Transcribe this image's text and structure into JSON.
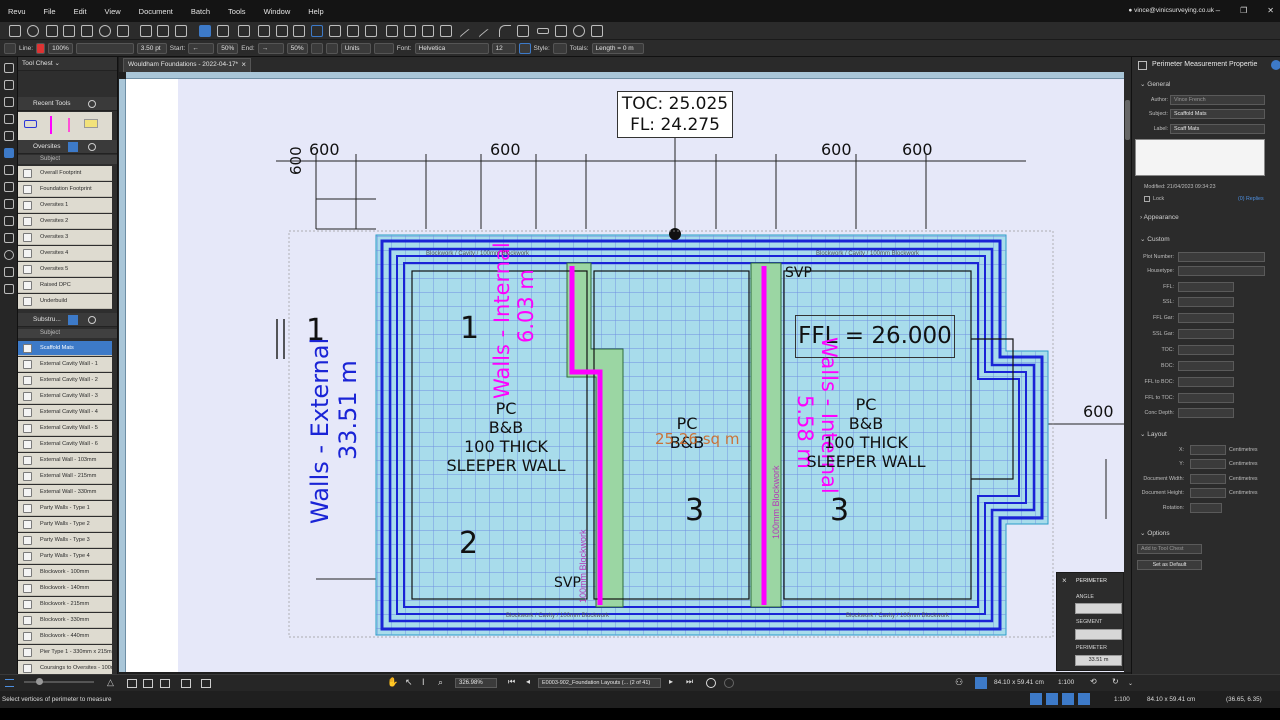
{
  "menubar": {
    "items": [
      "Revu",
      "File",
      "Edit",
      "View",
      "Document",
      "Batch",
      "Tools",
      "Window",
      "Help"
    ],
    "user_email": "vince@vinicsurveying.co.uk"
  },
  "toolbar2": {
    "line_label": "Line:",
    "opacity": "100%",
    "thickness": "3.50 pt",
    "start_label": "Start:",
    "start_pct": "50%",
    "end_label": "End:",
    "end_pct": "50%",
    "units_label": "Units",
    "font_label": "Font:",
    "font_value": "Helvetica",
    "font_size": "12",
    "style_label": "Style:",
    "totals_label": "Totals:",
    "totals_value": "Length = 0 m"
  },
  "toolchest": {
    "title": "Tool Chest",
    "recent_tools": "Recent Tools",
    "group1_name": "Oversites",
    "subject_header": "Subject",
    "group1_items": [
      "Overall Footprint",
      "Foundation Footprint",
      "Oversites 1",
      "Oversites 2",
      "Oversites 3",
      "Oversites 4",
      "Oversites 5",
      "Raised DPC",
      "Underbuild"
    ],
    "group2_name": "Substru...",
    "group2_items": [
      "Scaffold Mats",
      "External Cavity Wall - 1",
      "External Cavity Wall - 2",
      "External Cavity Wall - 3",
      "External Cavity Wall - 4",
      "External Cavity Wall - 5",
      "External Cavity Wall - 6",
      "External Wall - 103mm",
      "External Wall - 215mm",
      "External Wall - 330mm",
      "Party Walls - Type 1",
      "Party Walls - Type 2",
      "Party Walls - Type 3",
      "Party Walls - Type 4",
      "Blockwork - 100mm",
      "Blockwork - 140mm",
      "Blockwork - 215mm",
      "Blockwork - 330mm",
      "Blockwork - 440mm",
      "Pier Type 1 - 330mm x 215mm",
      "Coursings to Oversites - 100mm..."
    ]
  },
  "document": {
    "tab_title": "Wouldham Foundations - 2022-04-17*"
  },
  "drawing": {
    "toc_label": "TOC: 25.025",
    "fl_label": "FL: 24.275",
    "dim_600": "600",
    "ffl_label": "FFL = 26.000",
    "walls_external": "Walls - External",
    "walls_external_len": "33.51 m",
    "walls_internal_a": "Walls - Internal",
    "walls_internal_a_len": "6.03 m",
    "walls_internal_b": "Walls - Internal",
    "walls_internal_b_len": "5.58 m",
    "plot_1": "1",
    "plot_2": "2",
    "plot_3": "3",
    "pc": "PC",
    "bb": "B&B",
    "sleeper_1": "100 THICK",
    "sleeper_2": "SLEEPER WALL",
    "svp": "SVP",
    "area_text": "25.26 sq m",
    "blockwork_label": "100mm Blockwork",
    "cavity_label": "Blockwork / Cavity / 100mm Blockwork"
  },
  "perimeter_popup": {
    "title": "PERIMETER",
    "angle_label": "ANGLE",
    "segment_label": "SEGMENT",
    "perimeter_label": "PERIMETER",
    "perimeter_value": "33.51 m"
  },
  "properties": {
    "title": "Perimeter Measurement Propertie",
    "general": "General",
    "author_label": "Author:",
    "author_value": "Vince French",
    "subject_label": "Subject:",
    "subject_value": "Scaffold Mats",
    "label_label": "Label:",
    "label_value": "Scaff Mats",
    "modified": "Modified: 21/04/2023 09:34:23",
    "lock": "Lock",
    "replies": "(0) Replies",
    "appearance": "Appearance",
    "custom": "Custom",
    "custom_fields": [
      "Plot Number:",
      "Housetype:",
      "FFL:",
      "SSL:",
      "FFL Gar:",
      "SSL Gar:",
      "TOC:",
      "BOC:",
      "FFL to BOC:",
      "FFL to TOC:",
      "Conc Depth:"
    ],
    "layout": "Layout",
    "layout_fields": [
      "X:",
      "Y:",
      "Document Width:",
      "Document Height:",
      "Rotation:"
    ],
    "units": "Centimetres",
    "options": "Options",
    "add_to_toolchest": "Add to Tool Chest",
    "set_as_default": "Set as Default"
  },
  "bottombar": {
    "zoom": "326.98%",
    "page_label": "E0003-902_Foundation Layouts (... (2 of 41)",
    "page_size": "84.10 x 59.41 cm",
    "scale": "1:100"
  },
  "statusbar": {
    "message": "Select vertices of perimeter to measure",
    "scale": "1:100",
    "page_size": "84.10 x 59.41 cm",
    "coords": "(36.65, 6.35)"
  },
  "colors": {
    "accent": "#3d7ac8",
    "wall_blue": "#1a24d6",
    "magenta": "#ff00ff",
    "measure_fill": "#a8dceb"
  }
}
